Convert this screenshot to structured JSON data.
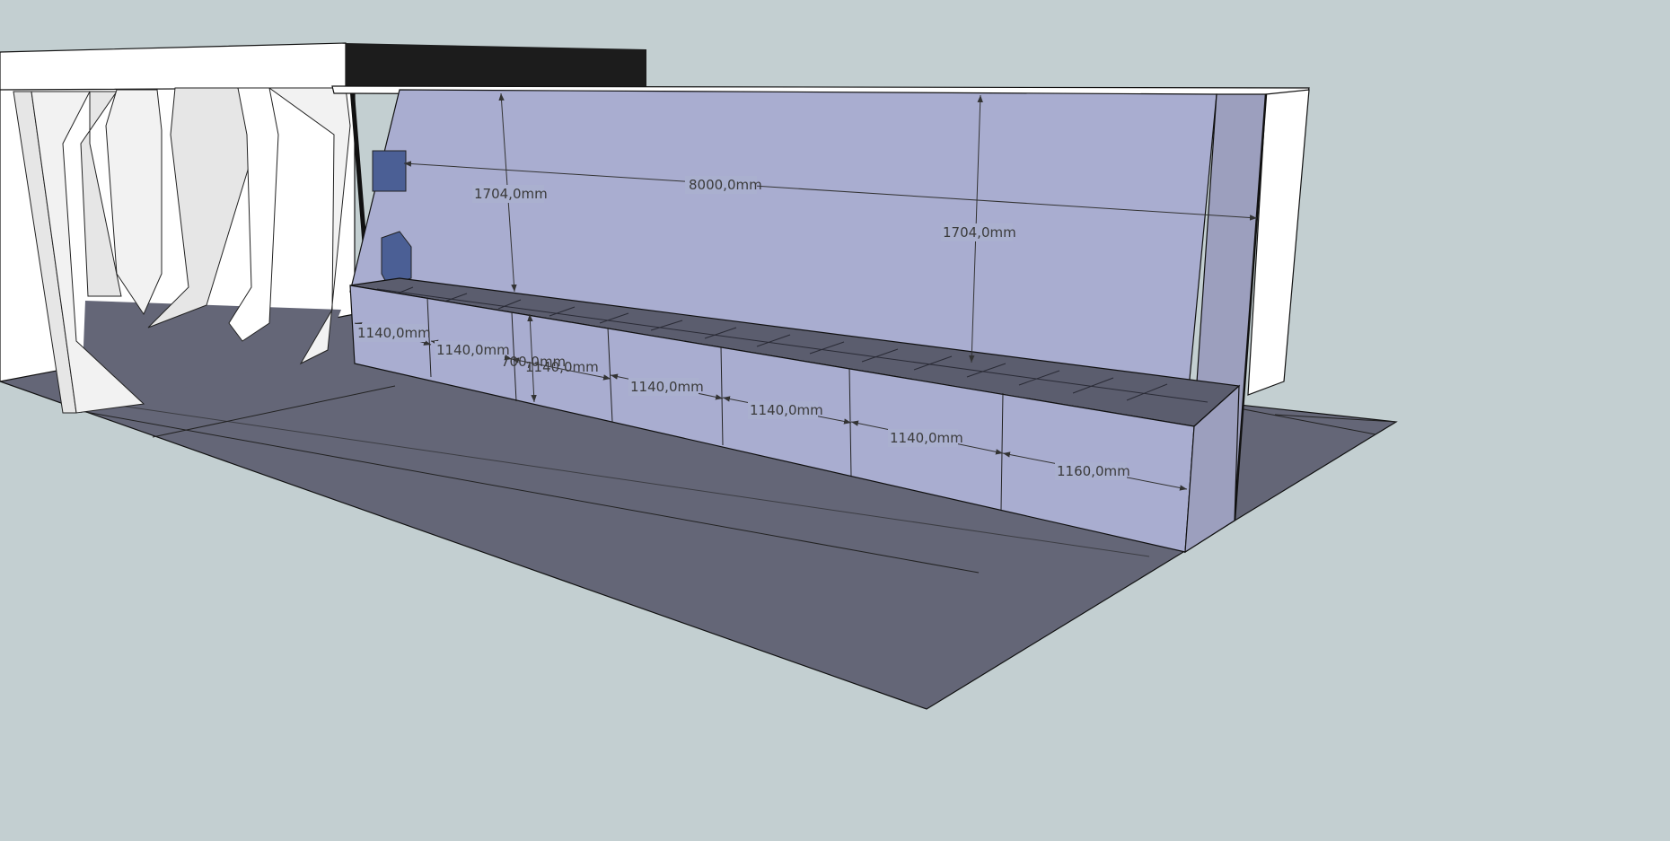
{
  "scene": {
    "background": "#c3cfd1",
    "floor_color": "#646677",
    "wall_color": "#a9add0",
    "wall_side_color": "#9c9fbe",
    "bench_top_color": "#5b5d6e",
    "cabin_white": "#ffffff",
    "cabin_gray": "#e6e6e6",
    "roof_dark": "#1c1c1c",
    "panel_blue": "#4b5f95"
  },
  "dimensions": {
    "wall_length": "8000,0mm",
    "wall_height_left": "1704,0mm",
    "wall_height_right": "1704,0mm",
    "bench_height": "700,0mm",
    "module_1": "1140,0mm",
    "module_2": "1140,0mm",
    "module_3": "1140,0mm",
    "module_4": "1140,0mm",
    "module_5": "1140,0mm",
    "module_6": "1140,0mm",
    "module_7": "1160,0mm"
  }
}
